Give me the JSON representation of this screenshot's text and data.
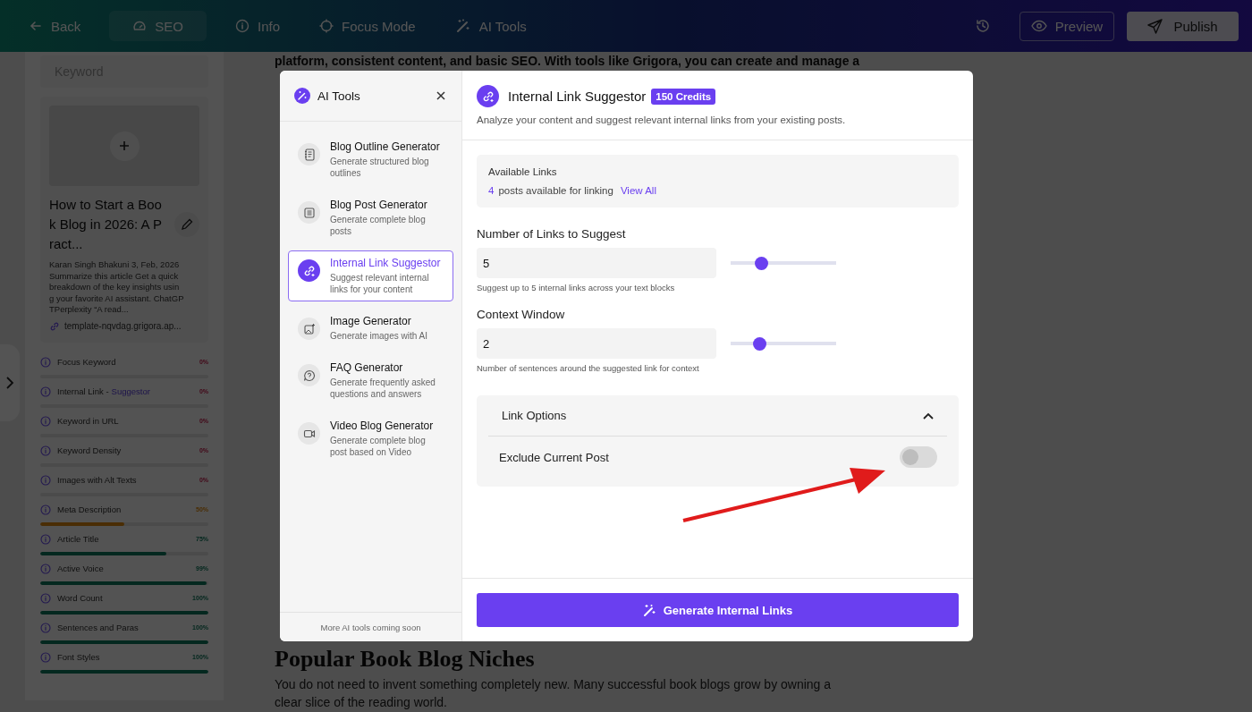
{
  "topbar": {
    "nav": [
      {
        "label": "Back",
        "selected": false
      },
      {
        "label": "SEO",
        "selected": true
      },
      {
        "label": "Info",
        "selected": false
      },
      {
        "label": "Focus Mode",
        "selected": false
      },
      {
        "label": "AI Tools",
        "selected": false
      }
    ],
    "preview": "Preview",
    "publish": "Publish"
  },
  "sidebar": {
    "keyword_placeholder": "Keyword",
    "post": {
      "title": "How to Start a Boo k Blog in 2026: A Pract...",
      "excerpt": "Karan Singh Bhakuni 3, Feb, 2026 Summarize this article Get a quick breakdown of the key insights usin g your favorite AI assistant. ChatGP TPerplexity “A read...",
      "url": "template-nqvdag.grigora.ap..."
    },
    "checks": [
      {
        "label": "Focus Keyword",
        "percent": "0%",
        "level": 0
      },
      {
        "label": "Internal Link -",
        "link": "Suggestor",
        "percent": "0%",
        "level": 0
      },
      {
        "label": "Keyword in URL",
        "percent": "0%",
        "level": 0
      },
      {
        "label": "Keyword Density",
        "percent": "0%",
        "level": 0
      },
      {
        "label": "Images with Alt Texts",
        "percent": "0%",
        "level": 0
      },
      {
        "label": "Meta Description",
        "percent": "50%",
        "level": 0.5
      },
      {
        "label": "Article Title",
        "percent": "75%",
        "level": 0.75
      },
      {
        "label": "Active Voice",
        "percent": "99%",
        "level": 0.99
      },
      {
        "label": "Word Count",
        "percent": "100%",
        "level": 1
      },
      {
        "label": "Sentences and Paras",
        "percent": "100%",
        "level": 1
      },
      {
        "label": "Font Styles",
        "percent": "100%",
        "level": 1
      }
    ]
  },
  "editor": {
    "intro": "platform, consistent content, and basic SEO. With tools like Grigora, you can create and manage a",
    "heading": "Popular Book Blog Niches",
    "paragraph": "You do not need to invent something completely new. Many successful book blogs grow by owning a clear slice of the reading world."
  },
  "modal": {
    "title": "AI Tools",
    "footer": "More AI tools coming soon",
    "tools": [
      {
        "name": "Blog Outline Generator",
        "desc": "Generate structured blog outlines",
        "selected": false
      },
      {
        "name": "Blog Post Generator",
        "desc": "Generate complete blog posts",
        "selected": false
      },
      {
        "name": "Internal Link Suggestor",
        "desc": "Suggest relevant internal links for your content",
        "selected": true
      },
      {
        "name": "Image Generator",
        "desc": "Generate images with AI",
        "selected": false
      },
      {
        "name": "FAQ Generator",
        "desc": "Generate frequently asked questions and answers",
        "selected": false
      },
      {
        "name": "Video Blog Generator",
        "desc": "Generate complete blog post based on Video",
        "selected": false
      }
    ],
    "panel": {
      "title": "Internal Link Suggestor",
      "credits": "150 Credits",
      "description": "Analyze your content and suggest relevant internal links from your existing posts.",
      "available": {
        "title": "Available Links",
        "count": "4",
        "text": "posts available for linking",
        "link": "View All"
      },
      "fields": [
        {
          "label": "Number of Links to Suggest",
          "value": "5",
          "level": 0.3,
          "hint": "Suggest up to 5 internal links across your text blocks"
        },
        {
          "label": "Context Window",
          "value": "2",
          "level": 0.28,
          "hint": "Number of sentences around the suggested link for context"
        }
      ],
      "options": {
        "title": "Link Options",
        "expanded": true,
        "toggles": [
          {
            "label": "Exclude Current Post",
            "on": false
          }
        ]
      },
      "button": "Generate Internal Links"
    }
  }
}
